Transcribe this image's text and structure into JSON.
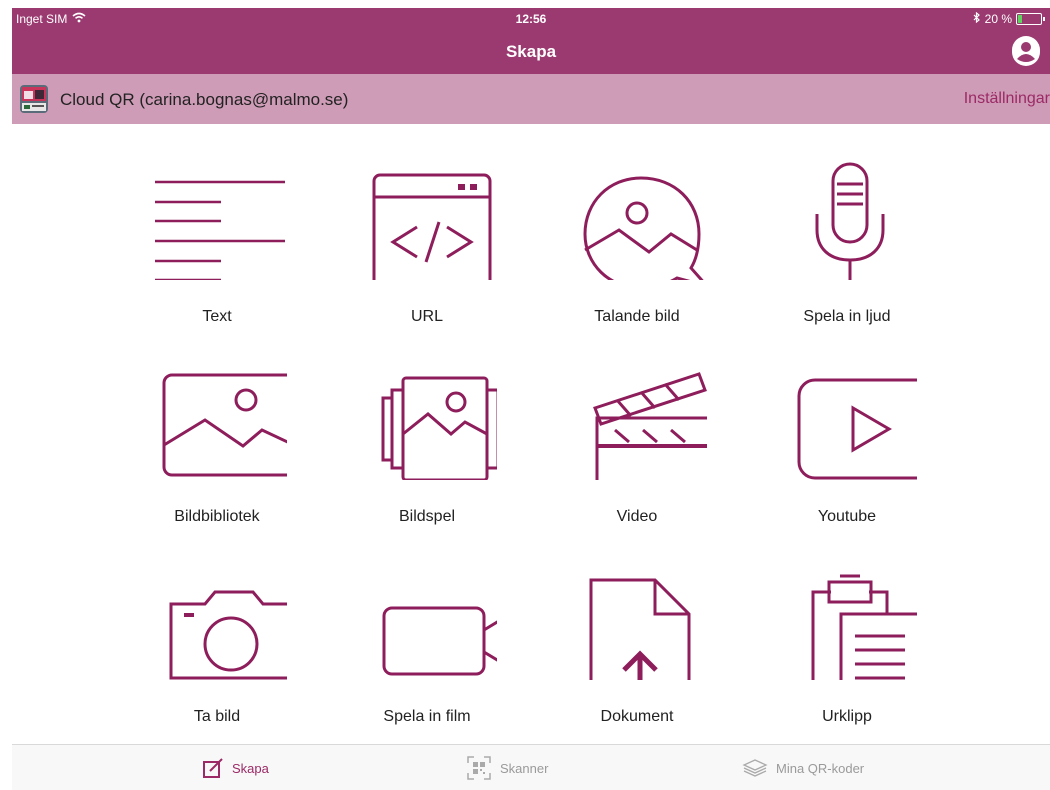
{
  "status_bar": {
    "carrier": "Inget SIM",
    "time": "12:56",
    "battery_text": "20 %",
    "battery_level": 0.2
  },
  "nav": {
    "title": "Skapa"
  },
  "account": {
    "label": "Cloud QR (carina.bognas@malmo.se)",
    "settings_label": "Inställningar"
  },
  "grid": {
    "items": [
      {
        "label": "Text",
        "icon": "text-lines-icon"
      },
      {
        "label": "URL",
        "icon": "code-window-icon"
      },
      {
        "label": "Talande bild",
        "icon": "speech-image-icon"
      },
      {
        "label": "Spela in ljud",
        "icon": "microphone-icon"
      },
      {
        "label": "Bildbibliotek",
        "icon": "image-icon"
      },
      {
        "label": "Bildspel",
        "icon": "slideshow-icon"
      },
      {
        "label": "Video",
        "icon": "clapperboard-icon"
      },
      {
        "label": "Youtube",
        "icon": "play-button-icon"
      },
      {
        "label": "Ta bild",
        "icon": "camera-icon"
      },
      {
        "label": "Spela in film",
        "icon": "video-camera-icon"
      },
      {
        "label": "Dokument",
        "icon": "document-upload-icon"
      },
      {
        "label": "Urklipp",
        "icon": "clipboard-icon"
      }
    ]
  },
  "tabs": [
    {
      "label": "Skapa",
      "icon": "edit-icon",
      "active": true
    },
    {
      "label": "Skanner",
      "icon": "qr-scan-icon",
      "active": false
    },
    {
      "label": "Mina QR-koder",
      "icon": "layers-icon",
      "active": false
    }
  ],
  "colors": {
    "accent": "#9b2a66",
    "bar": "#9b3a70",
    "account_bar": "#cf9cb7",
    "tab_inactive": "#9a9a9a"
  }
}
